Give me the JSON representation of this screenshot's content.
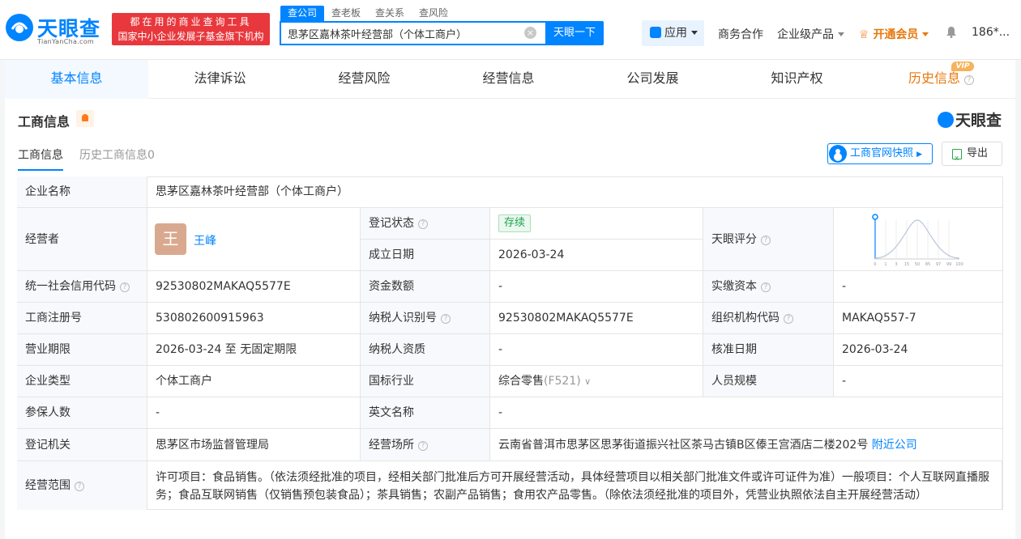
{
  "header": {
    "logo_text": "天眼查",
    "logo_sub": "TianYanCha.com",
    "slogan_line1": "都在用的商业查询工具",
    "slogan_line2": "国家中小企业发展子基金旗下机构",
    "search_tabs": [
      "查公司",
      "查老板",
      "查关系",
      "查风险"
    ],
    "search_value": "思茅区嘉林茶叶经营部（个体工商户）",
    "search_button": "天眼一下",
    "app_label": "应用",
    "biz_coop": "商务合作",
    "enterprise_products": "企业级产品",
    "vip_label": "开通会员",
    "user_label": "186*..."
  },
  "tabs": [
    "基本信息",
    "法律诉讼",
    "经营风险",
    "经营信息",
    "公司发展",
    "知识产权",
    "历史信息"
  ],
  "vip_badge": "VIP",
  "section": {
    "title": "工商信息",
    "brand": "天眼查",
    "subtab_active": "工商信息",
    "subtab_history": "历史工商信息0",
    "snapshot_button": "工商官网快照",
    "export_button": "导出"
  },
  "table": {
    "company_name_label": "企业名称",
    "company_name": "思茅区嘉林茶叶经营部（个体工商户）",
    "operator_label": "经营者",
    "operator_avatar": "王",
    "operator_name": "王峰",
    "reg_status_label": "登记状态",
    "reg_status": "存续",
    "founded_label": "成立日期",
    "founded": "2026-03-24",
    "score_label": "天眼评分",
    "score_axis": [
      "0",
      "1",
      "3",
      "15",
      "50",
      "85",
      "97",
      "99",
      "100"
    ],
    "credit_code_label": "统一社会信用代码",
    "credit_code": "92530802MAKAQ5577E",
    "capital_label": "资金数额",
    "capital": "-",
    "paid_capital_label": "实缴资本",
    "paid_capital": "-",
    "reg_no_label": "工商注册号",
    "reg_no": "530802600915963",
    "taxpayer_id_label": "纳税人识别号",
    "taxpayer_id": "92530802MAKAQ5577E",
    "org_code_label": "组织机构代码",
    "org_code": "MAKAQ557-7",
    "term_label": "营业期限",
    "term": "2026-03-24 至 无固定期限",
    "taxpayer_qual_label": "纳税人资质",
    "taxpayer_qual": "-",
    "approve_date_label": "核准日期",
    "approve_date": "2026-03-24",
    "type_label": "企业类型",
    "type": "个体工商户",
    "industry_label": "国标行业",
    "industry": "综合零售",
    "industry_code": "(F521)",
    "staff_label": "人员规模",
    "staff": "-",
    "insured_label": "参保人数",
    "insured": "-",
    "en_name_label": "英文名称",
    "en_name": "-",
    "authority_label": "登记机关",
    "authority": "思茅区市场监督管理局",
    "address_label": "经营场所",
    "address": "云南省普洱市思茅区思茅街道振兴社区茶马古镇B区傣王宫酒店二楼202号",
    "nearby": "附近公司",
    "scope_label": "经营范围",
    "scope": "许可项目：食品销售。（依法须经批准的项目，经相关部门批准后方可开展经营活动，具体经营项目以相关部门批准文件或许可证件为准）一般项目：个人互联网直播服务；食品互联网销售（仅销售预包装食品）；茶具销售；农副产品销售；食用农产品零售。（除依法须经批准的项目外，凭营业执照依法自主开展经营活动）"
  }
}
